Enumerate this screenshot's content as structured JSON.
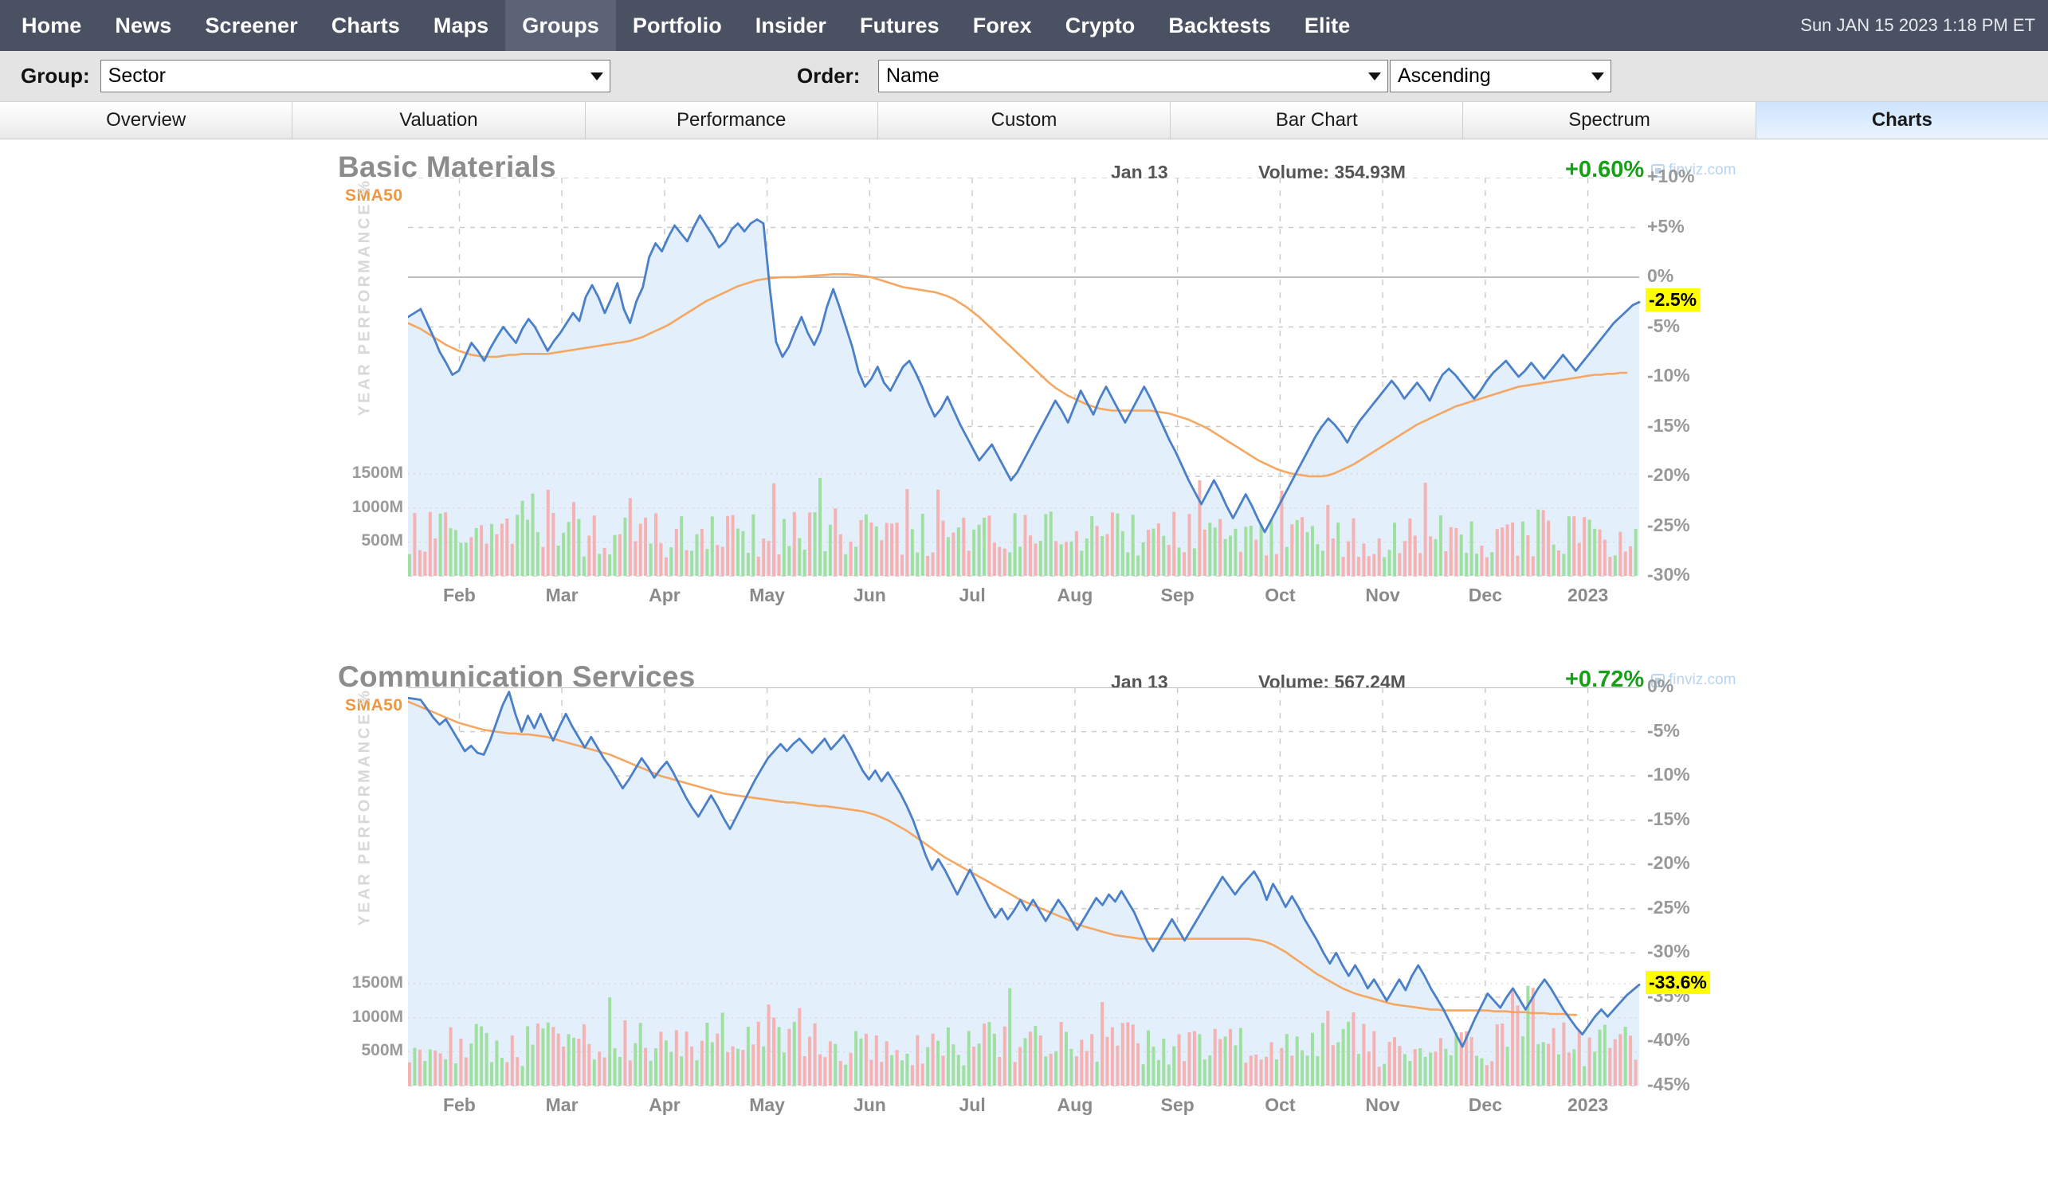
{
  "nav": {
    "items": [
      {
        "label": "Home",
        "active": false
      },
      {
        "label": "News",
        "active": false
      },
      {
        "label": "Screener",
        "active": false
      },
      {
        "label": "Charts",
        "active": false
      },
      {
        "label": "Maps",
        "active": false
      },
      {
        "label": "Groups",
        "active": true
      },
      {
        "label": "Portfolio",
        "active": false
      },
      {
        "label": "Insider",
        "active": false
      },
      {
        "label": "Futures",
        "active": false
      },
      {
        "label": "Forex",
        "active": false
      },
      {
        "label": "Crypto",
        "active": false
      },
      {
        "label": "Backtests",
        "active": false
      },
      {
        "label": "Elite",
        "active": false
      }
    ],
    "clock": "Sun JAN 15 2023 1:18 PM ET"
  },
  "controls": {
    "group_label": "Group:",
    "group_value": "Sector",
    "order_label": "Order:",
    "order_value": "Name",
    "direction_value": "Ascending"
  },
  "tabs": [
    {
      "label": "Overview",
      "active": false
    },
    {
      "label": "Valuation",
      "active": false
    },
    {
      "label": "Performance",
      "active": false
    },
    {
      "label": "Custom",
      "active": false
    },
    {
      "label": "Bar Chart",
      "active": false
    },
    {
      "label": "Spectrum",
      "active": false
    },
    {
      "label": "Charts",
      "active": true
    }
  ],
  "watermark": "finviz.com",
  "sma_label": "SMA50",
  "yaxis_title": "YEAR PERFORMANCE %",
  "volume_ticks": [
    "1500M",
    "1000M",
    "500M"
  ],
  "chart_data": [
    {
      "type": "line",
      "title": "Basic Materials",
      "date": "Jan 13",
      "volume_label": "Volume: 354.93M",
      "change": "+0.60%",
      "change_color": "#15a015",
      "current_value_label": "-2.5%",
      "current_value": -2.5,
      "xlabel": "",
      "ylabel": "YEAR PERFORMANCE %",
      "ylim": [
        -30,
        10
      ],
      "yticks": [
        10,
        5,
        0,
        -5,
        -10,
        -15,
        -20,
        -25,
        -30
      ],
      "ytick_labels": [
        "+10%",
        "+5%",
        "0%",
        "-5%",
        "-10%",
        "-15%",
        "-20%",
        "-25%",
        "-30%"
      ],
      "xticks": [
        "Feb",
        "Mar",
        "Apr",
        "May",
        "Jun",
        "Jul",
        "Aug",
        "Sep",
        "Oct",
        "Nov",
        "Dec",
        "2023"
      ],
      "grid": true,
      "legend": [
        "Year Performance %",
        "SMA50"
      ],
      "series": [
        {
          "name": "Year Performance %",
          "color": "#4a7fc9",
          "values": [
            -4.0,
            -3.6,
            -3.2,
            -4.6,
            -6.0,
            -7.5,
            -8.6,
            -9.8,
            -9.4,
            -8.0,
            -6.6,
            -7.4,
            -8.4,
            -7.1,
            -6.0,
            -5.0,
            -5.8,
            -6.6,
            -5.2,
            -4.2,
            -5.0,
            -6.2,
            -7.4,
            -6.4,
            -5.6,
            -4.6,
            -3.6,
            -4.4,
            -2.0,
            -0.8,
            -2.0,
            -3.6,
            -2.2,
            -0.6,
            -3.2,
            -4.6,
            -2.4,
            -1.0,
            2.0,
            3.4,
            2.6,
            4.0,
            5.2,
            4.4,
            3.6,
            5.0,
            6.2,
            5.2,
            4.2,
            3.0,
            3.6,
            4.8,
            5.4,
            4.6,
            5.4,
            5.8,
            5.4,
            -1.0,
            -6.5,
            -8.0,
            -7.0,
            -5.4,
            -4.0,
            -5.6,
            -6.8,
            -5.4,
            -3.0,
            -1.2,
            -3.0,
            -5.0,
            -7.0,
            -9.5,
            -11.0,
            -10.2,
            -9.0,
            -10.6,
            -11.4,
            -10.2,
            -9.0,
            -8.4,
            -9.6,
            -11.0,
            -12.6,
            -14.0,
            -13.2,
            -12.0,
            -13.4,
            -14.8,
            -16.0,
            -17.2,
            -18.4,
            -17.6,
            -16.8,
            -18.0,
            -19.2,
            -20.4,
            -19.6,
            -18.4,
            -17.2,
            -16.0,
            -14.8,
            -13.6,
            -12.4,
            -13.4,
            -14.6,
            -13.0,
            -11.4,
            -12.6,
            -13.8,
            -12.2,
            -11.0,
            -12.2,
            -13.4,
            -14.6,
            -13.4,
            -12.2,
            -11.0,
            -12.2,
            -13.6,
            -15.0,
            -16.4,
            -17.6,
            -19.0,
            -20.4,
            -21.6,
            -22.8,
            -21.6,
            -20.4,
            -21.6,
            -23.0,
            -24.2,
            -23.0,
            -21.8,
            -23.0,
            -24.4,
            -25.6,
            -24.4,
            -23.2,
            -22.0,
            -20.8,
            -19.6,
            -18.4,
            -17.2,
            -16.0,
            -15.0,
            -14.2,
            -14.8,
            -15.6,
            -16.6,
            -15.4,
            -14.4,
            -13.6,
            -12.8,
            -12.0,
            -11.2,
            -10.4,
            -11.2,
            -12.2,
            -11.4,
            -10.6,
            -11.4,
            -12.4,
            -11.0,
            -9.8,
            -9.2,
            -9.8,
            -10.6,
            -11.4,
            -12.2,
            -11.4,
            -10.4,
            -9.6,
            -9.0,
            -8.4,
            -9.2,
            -10.0,
            -9.4,
            -8.6,
            -9.4,
            -10.2,
            -9.4,
            -8.6,
            -7.8,
            -8.6,
            -9.4,
            -8.6,
            -7.8,
            -7.0,
            -6.2,
            -5.4,
            -4.6,
            -4.0,
            -3.4,
            -2.8,
            -2.5
          ]
        },
        {
          "name": "SMA50",
          "color": "#f5a25a",
          "values": [
            -4.6,
            -4.9,
            -5.2,
            -5.6,
            -6.0,
            -6.4,
            -6.8,
            -7.1,
            -7.4,
            -7.6,
            -7.8,
            -7.9,
            -8.0,
            -8.0,
            -8.0,
            -7.9,
            -7.8,
            -7.8,
            -7.7,
            -7.7,
            -7.7,
            -7.7,
            -7.7,
            -7.6,
            -7.5,
            -7.4,
            -7.3,
            -7.2,
            -7.1,
            -7.0,
            -6.9,
            -6.8,
            -6.7,
            -6.6,
            -6.5,
            -6.4,
            -6.2,
            -6.0,
            -5.7,
            -5.4,
            -5.1,
            -4.8,
            -4.4,
            -4.0,
            -3.6,
            -3.2,
            -2.8,
            -2.4,
            -2.1,
            -1.8,
            -1.5,
            -1.2,
            -0.9,
            -0.7,
            -0.5,
            -0.3,
            -0.2,
            -0.1,
            -0.05,
            0.0,
            0.0,
            0.0,
            0.05,
            0.1,
            0.15,
            0.2,
            0.25,
            0.3,
            0.3,
            0.3,
            0.25,
            0.2,
            0.1,
            0.0,
            -0.2,
            -0.4,
            -0.6,
            -0.8,
            -1.0,
            -1.1,
            -1.2,
            -1.3,
            -1.4,
            -1.5,
            -1.7,
            -1.9,
            -2.2,
            -2.6,
            -3.0,
            -3.5,
            -4.0,
            -4.6,
            -5.2,
            -5.8,
            -6.4,
            -7.0,
            -7.6,
            -8.2,
            -8.8,
            -9.4,
            -10.0,
            -10.6,
            -11.1,
            -11.5,
            -11.9,
            -12.2,
            -12.5,
            -12.8,
            -13.0,
            -13.2,
            -13.3,
            -13.4,
            -13.4,
            -13.4,
            -13.4,
            -13.4,
            -13.4,
            -13.4,
            -13.5,
            -13.6,
            -13.7,
            -13.9,
            -14.1,
            -14.3,
            -14.6,
            -14.9,
            -15.2,
            -15.6,
            -16.0,
            -16.4,
            -16.8,
            -17.2,
            -17.6,
            -18.0,
            -18.4,
            -18.7,
            -19.0,
            -19.3,
            -19.5,
            -19.7,
            -19.8,
            -19.9,
            -20.0,
            -20.0,
            -20.0,
            -19.9,
            -19.7,
            -19.4,
            -19.1,
            -18.8,
            -18.4,
            -18.0,
            -17.6,
            -17.2,
            -16.8,
            -16.4,
            -16.0,
            -15.6,
            -15.2,
            -14.8,
            -14.5,
            -14.2,
            -13.9,
            -13.6,
            -13.3,
            -13.0,
            -12.8,
            -12.6,
            -12.4,
            -12.2,
            -12.0,
            -11.8,
            -11.6,
            -11.4,
            -11.2,
            -11.0,
            -10.9,
            -10.8,
            -10.7,
            -10.6,
            -10.5,
            -10.4,
            -10.3,
            -10.2,
            -10.1,
            -10.0,
            -9.9,
            -9.8,
            -9.8,
            -9.7,
            -9.7,
            -9.6,
            -9.6
          ]
        }
      ],
      "volume_axis_ticks": [
        "1500M",
        "1000M",
        "500M"
      ],
      "volume_max": 2000
    },
    {
      "type": "line",
      "title": "Communication Services",
      "date": "Jan 13",
      "volume_label": "Volume: 567.24M",
      "change": "+0.72%",
      "change_color": "#15a015",
      "current_value_label": "-33.6%",
      "current_value": -33.6,
      "xlabel": "",
      "ylabel": "YEAR PERFORMANCE %",
      "ylim": [
        -45,
        0
      ],
      "yticks": [
        0,
        -5,
        -10,
        -15,
        -20,
        -25,
        -30,
        -35,
        -40,
        -45
      ],
      "ytick_labels": [
        "0%",
        "-5%",
        "-10%",
        "-15%",
        "-20%",
        "-25%",
        "-30%",
        "-35%",
        "-40%",
        "-45%"
      ],
      "xticks": [
        "Feb",
        "Mar",
        "Apr",
        "May",
        "Jun",
        "Jul",
        "Aug",
        "Sep",
        "Oct",
        "Nov",
        "Dec",
        "2023"
      ],
      "grid": true,
      "legend": [
        "Year Performance %",
        "SMA50"
      ],
      "series": [
        {
          "name": "Year Performance %",
          "color": "#4a7fc9",
          "values": [
            -1.2,
            -1.3,
            -1.4,
            -2.4,
            -3.4,
            -4.2,
            -3.6,
            -4.8,
            -6.0,
            -7.2,
            -6.6,
            -7.4,
            -7.6,
            -6.0,
            -4.0,
            -2.0,
            -0.5,
            -3.0,
            -5.0,
            -3.2,
            -4.6,
            -3.0,
            -4.6,
            -6.0,
            -4.4,
            -3.0,
            -4.4,
            -5.6,
            -6.8,
            -5.6,
            -6.8,
            -8.0,
            -9.0,
            -10.2,
            -11.4,
            -10.4,
            -9.2,
            -8.0,
            -9.0,
            -10.2,
            -9.2,
            -8.4,
            -9.6,
            -11.0,
            -12.4,
            -13.6,
            -14.6,
            -13.4,
            -12.2,
            -13.4,
            -14.8,
            -16.0,
            -14.6,
            -13.2,
            -11.8,
            -10.4,
            -9.2,
            -8.0,
            -7.2,
            -6.4,
            -7.2,
            -6.4,
            -5.8,
            -6.6,
            -7.4,
            -6.6,
            -5.8,
            -7.0,
            -6.2,
            -5.4,
            -6.6,
            -8.0,
            -9.4,
            -10.4,
            -9.4,
            -10.6,
            -9.6,
            -10.8,
            -12.0,
            -13.4,
            -15.0,
            -17.0,
            -19.0,
            -20.6,
            -19.4,
            -20.6,
            -22.0,
            -23.4,
            -22.0,
            -20.6,
            -22.0,
            -23.4,
            -24.8,
            -26.0,
            -25.0,
            -26.2,
            -25.2,
            -24.0,
            -25.2,
            -24.0,
            -25.2,
            -26.4,
            -25.2,
            -24.0,
            -25.0,
            -26.2,
            -27.4,
            -26.2,
            -25.0,
            -23.8,
            -24.6,
            -23.4,
            -24.2,
            -23.0,
            -24.2,
            -25.4,
            -27.0,
            -28.6,
            -29.8,
            -28.6,
            -27.4,
            -26.2,
            -27.4,
            -28.6,
            -27.4,
            -26.2,
            -25.0,
            -23.8,
            -22.6,
            -21.4,
            -22.4,
            -23.4,
            -22.4,
            -21.6,
            -20.8,
            -22.0,
            -24.0,
            -22.2,
            -23.4,
            -24.8,
            -23.6,
            -24.8,
            -26.2,
            -27.4,
            -28.6,
            -30.0,
            -31.2,
            -30.0,
            -31.4,
            -32.6,
            -31.4,
            -32.6,
            -34.0,
            -33.0,
            -34.2,
            -35.4,
            -34.2,
            -33.0,
            -34.2,
            -32.6,
            -31.4,
            -32.6,
            -34.0,
            -35.2,
            -36.4,
            -37.8,
            -39.2,
            -40.6,
            -39.0,
            -37.4,
            -36.0,
            -34.6,
            -35.4,
            -36.2,
            -35.0,
            -34.0,
            -35.2,
            -36.4,
            -35.2,
            -34.0,
            -33.0,
            -34.0,
            -35.2,
            -36.4,
            -37.4,
            -38.4,
            -39.2,
            -38.2,
            -37.2,
            -36.4,
            -37.2,
            -36.4,
            -35.6,
            -34.8,
            -34.2,
            -33.6
          ]
        },
        {
          "name": "SMA50",
          "color": "#f5a25a",
          "values": [
            -1.6,
            -1.9,
            -2.2,
            -2.5,
            -2.8,
            -3.1,
            -3.4,
            -3.7,
            -4.0,
            -4.2,
            -4.4,
            -4.6,
            -4.8,
            -4.9,
            -5.0,
            -5.1,
            -5.2,
            -5.2,
            -5.3,
            -5.3,
            -5.4,
            -5.5,
            -5.6,
            -5.8,
            -6.0,
            -6.2,
            -6.4,
            -6.6,
            -6.8,
            -7.0,
            -7.2,
            -7.4,
            -7.6,
            -7.9,
            -8.2,
            -8.5,
            -8.8,
            -9.1,
            -9.4,
            -9.7,
            -10.0,
            -10.2,
            -10.4,
            -10.6,
            -10.8,
            -11.0,
            -11.2,
            -11.4,
            -11.6,
            -11.8,
            -12.0,
            -12.1,
            -12.2,
            -12.3,
            -12.4,
            -12.5,
            -12.6,
            -12.7,
            -12.8,
            -12.9,
            -13.0,
            -13.0,
            -13.1,
            -13.2,
            -13.3,
            -13.4,
            -13.4,
            -13.5,
            -13.6,
            -13.7,
            -13.8,
            -13.9,
            -14.0,
            -14.2,
            -14.4,
            -14.7,
            -15.0,
            -15.4,
            -15.8,
            -16.2,
            -16.7,
            -17.2,
            -17.7,
            -18.2,
            -18.7,
            -19.2,
            -19.6,
            -20.0,
            -20.4,
            -20.8,
            -21.2,
            -21.6,
            -22.0,
            -22.4,
            -22.8,
            -23.2,
            -23.6,
            -24.0,
            -24.3,
            -24.6,
            -24.9,
            -25.2,
            -25.5,
            -25.8,
            -26.1,
            -26.4,
            -26.7,
            -27.0,
            -27.2,
            -27.4,
            -27.6,
            -27.8,
            -28.0,
            -28.1,
            -28.2,
            -28.3,
            -28.4,
            -28.4,
            -28.4,
            -28.4,
            -28.4,
            -28.4,
            -28.4,
            -28.4,
            -28.4,
            -28.4,
            -28.4,
            -28.4,
            -28.4,
            -28.4,
            -28.4,
            -28.4,
            -28.4,
            -28.4,
            -28.5,
            -28.6,
            -28.8,
            -29.1,
            -29.5,
            -29.9,
            -30.4,
            -30.9,
            -31.4,
            -31.9,
            -32.4,
            -32.8,
            -33.2,
            -33.6,
            -34.0,
            -34.3,
            -34.6,
            -34.8,
            -35.0,
            -35.2,
            -35.4,
            -35.6,
            -35.8,
            -35.9,
            -36.0,
            -36.1,
            -36.2,
            -36.3,
            -36.4,
            -36.4,
            -36.5,
            -36.5,
            -36.5,
            -36.5,
            -36.5,
            -36.5,
            -36.5,
            -36.5,
            -36.6,
            -36.6,
            -36.6,
            -36.7,
            -36.7,
            -36.7,
            -36.8,
            -36.8,
            -36.8,
            -36.9,
            -36.9,
            -36.9,
            -37.0,
            -37.0
          ]
        }
      ],
      "volume_axis_ticks": [
        "1500M",
        "1000M",
        "500M"
      ],
      "volume_max": 2000
    }
  ]
}
